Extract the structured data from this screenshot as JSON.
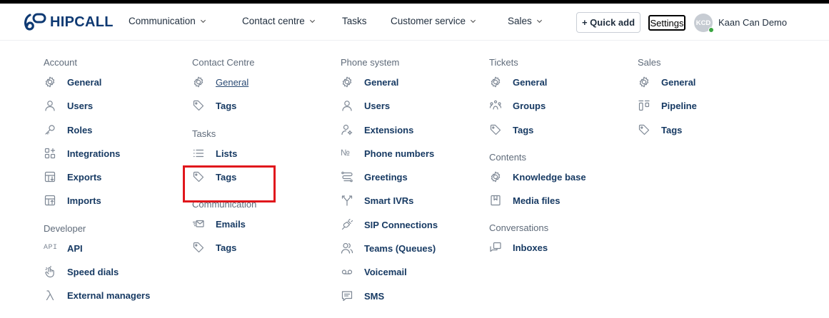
{
  "brand": {
    "name": "HIPCALL",
    "color": "#0f3a73"
  },
  "nav": {
    "communication": "Communication",
    "contact_centre": "Contact centre",
    "tasks": "Tasks",
    "customer_service": "Customer service",
    "sales": "Sales"
  },
  "header": {
    "quick_add": "+ Quick add",
    "settings": "Settings",
    "avatar_initials": "KCD",
    "user_name": "Kaan Can Demo"
  },
  "columns": {
    "c1": {
      "account": {
        "title": "Account",
        "items": [
          {
            "label": "General",
            "icon": "gear-icon"
          },
          {
            "label": "Users",
            "icon": "user-icon"
          },
          {
            "label": "Roles",
            "icon": "key-icon"
          },
          {
            "label": "Integrations",
            "icon": "grid-plus-icon"
          },
          {
            "label": "Exports",
            "icon": "export-icon"
          },
          {
            "label": "Imports",
            "icon": "import-icon"
          }
        ]
      },
      "developer": {
        "title": "Developer",
        "items": [
          {
            "label": "API",
            "icon": "api-icon",
            "icon_text": "API"
          },
          {
            "label": "Speed dials",
            "icon": "hand-tap-icon"
          },
          {
            "label": "External managers",
            "icon": "lambda-icon"
          }
        ]
      }
    },
    "c2": {
      "contact_centre": {
        "title": "Contact Centre",
        "items": [
          {
            "label": "General",
            "icon": "gear-icon"
          },
          {
            "label": "Tags",
            "icon": "tag-icon"
          }
        ]
      },
      "tasks": {
        "title": "Tasks",
        "items": [
          {
            "label": "Lists",
            "icon": "list-icon"
          },
          {
            "label": "Tags",
            "icon": "tag-icon"
          }
        ]
      },
      "communication": {
        "title": "Communication",
        "items": [
          {
            "label": "Emails",
            "icon": "mail-icon"
          },
          {
            "label": "Tags",
            "icon": "tag-icon"
          }
        ]
      }
    },
    "c3": {
      "phone_system": {
        "title": "Phone system",
        "items": [
          {
            "label": "General",
            "icon": "gear-icon"
          },
          {
            "label": "Users",
            "icon": "user-icon"
          },
          {
            "label": "Extensions",
            "icon": "user-gear-icon"
          },
          {
            "label": "Phone numbers",
            "icon": "numero-icon",
            "icon_text": "№"
          },
          {
            "label": "Greetings",
            "icon": "greeting-icon"
          },
          {
            "label": "Smart IVRs",
            "icon": "split-arrow-icon"
          },
          {
            "label": "SIP Connections",
            "icon": "plug-icon"
          },
          {
            "label": "Teams (Queues)",
            "icon": "team-icon"
          },
          {
            "label": "Voicemail",
            "icon": "voicemail-icon"
          },
          {
            "label": "SMS",
            "icon": "chat-icon"
          }
        ]
      }
    },
    "c4": {
      "tickets": {
        "title": "Tickets",
        "items": [
          {
            "label": "General",
            "icon": "gear-icon"
          },
          {
            "label": "Groups",
            "icon": "group-icon"
          },
          {
            "label": "Tags",
            "icon": "tag-icon"
          }
        ]
      },
      "contents": {
        "title": "Contents",
        "items": [
          {
            "label": "Knowledge base",
            "icon": "gear-icon"
          },
          {
            "label": "Media files",
            "icon": "media-icon"
          }
        ]
      },
      "conversations": {
        "title": "Conversations",
        "items": [
          {
            "label": "Inboxes",
            "icon": "inbox-icon"
          }
        ]
      }
    },
    "c5": {
      "sales": {
        "title": "Sales",
        "items": [
          {
            "label": "General",
            "icon": "gear-icon"
          },
          {
            "label": "Pipeline",
            "icon": "pipeline-icon"
          },
          {
            "label": "Tags",
            "icon": "tag-icon"
          }
        ]
      }
    }
  },
  "colors": {
    "highlight": "#e0171c",
    "status_online": "#3aa541",
    "link": "#173a63"
  }
}
